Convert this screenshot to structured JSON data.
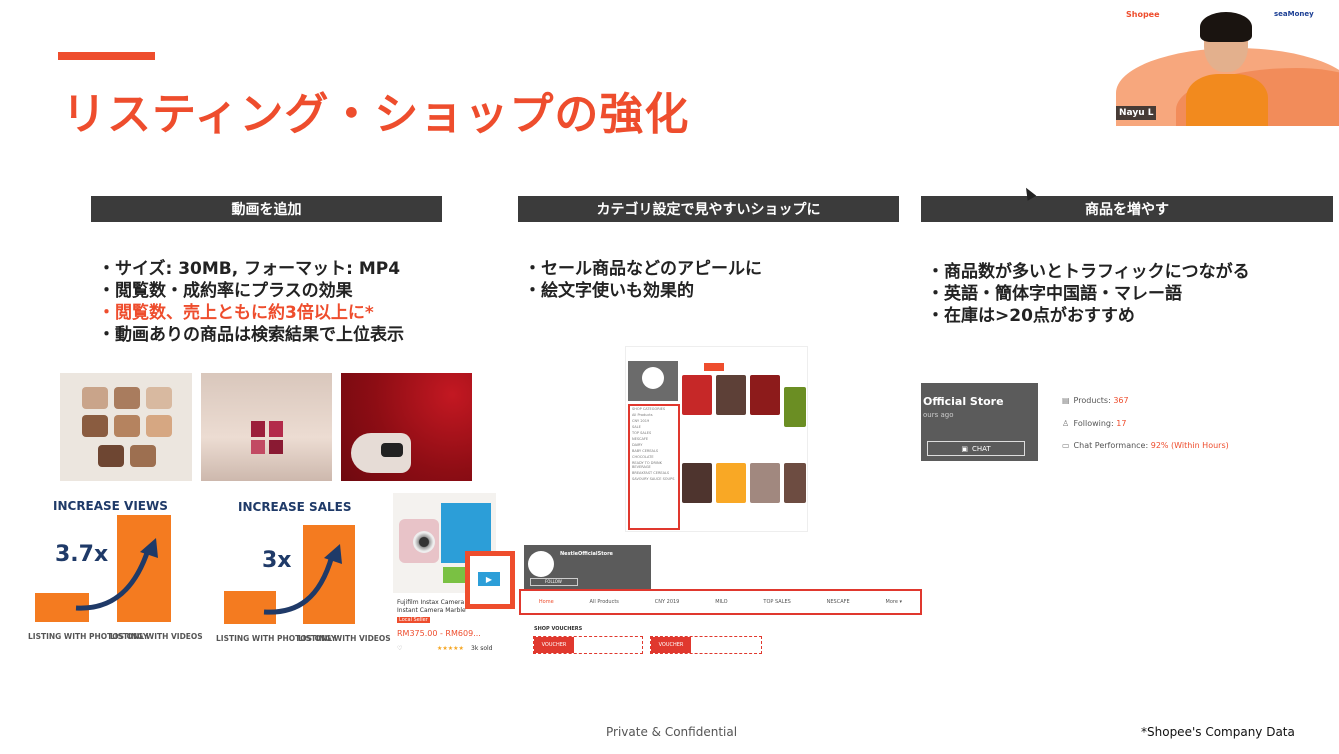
{
  "slide": {
    "title": "リスティング・ショップの強化",
    "accent_color": "#ee4d2d",
    "header_color": "#3b3b3b"
  },
  "columns": [
    {
      "header": "動画を追加",
      "bullets": [
        "・サイズ: 30MB, フォーマット: MP4",
        "・閲覧数・成約率にプラスの効果",
        "・閲覧数、売上ともに約3倍以上に*",
        "・動画ありの商品は検索結果で上位表示"
      ],
      "highlighted_bullet_index": 2
    },
    {
      "header": "カテゴリ設定で見やすいショップに",
      "bullets": [
        "・セール商品などのアピールに",
        "・絵文字使いも効果的"
      ]
    },
    {
      "header": "商品を増やす",
      "bullets": [
        "・商品数が多いとトラフィックにつながる",
        "・英語・簡体字中国語・マレー語",
        "・在庫は>20点がおすすめ"
      ]
    }
  ],
  "chart_data": [
    {
      "type": "bar",
      "title": "INCREASE VIEWS",
      "categories": [
        "LISTING WITH PHOTOS ONLY",
        "LISTING WITH VIDEOS"
      ],
      "values": [
        1,
        3.7
      ],
      "annotation": "3.7x",
      "bar_color": "#f47b20"
    },
    {
      "type": "bar",
      "title": "INCREASE SALES",
      "categories": [
        "LISTING WITH PHOTOS ONLY",
        "LISTING WITH VIDEOS"
      ],
      "values": [
        1,
        3
      ],
      "annotation": "3x",
      "bar_color": "#f47b20"
    }
  ],
  "product_card": {
    "name_line1": "Fujifilm Instax Camera",
    "name_line2": "Instant Camera Marble",
    "price": "RM375.00 - RM609...",
    "seller_tag": "Local Seller",
    "sold": "3k sold",
    "rating": "★★★★★"
  },
  "shop_screenshot": {
    "shop_name": "NestleOfficialStore",
    "follow_label": "FOLLOW",
    "tabs": [
      "Home",
      "All Products",
      "CNY 2019",
      "MILO",
      "TOP SALES",
      "NESCAFE",
      "More ▾"
    ],
    "section_label": "SHOP VOUCHERS",
    "voucher_label": "VOUCHER",
    "categories": [
      "SHOP CATEGORIES",
      "All Products",
      "CNY 2019",
      "SALE",
      "TOP SALES",
      "NESCAFE",
      "DAIRY",
      "BABY CEREALS",
      "CHOCOLATE",
      "READY TO DRINK BEVERAGE",
      "BREAKFAST CEREALS",
      "SAVOURY SAUCE SOUPS"
    ]
  },
  "store_card": {
    "name": "Official Store",
    "subtitle": "ours ago",
    "chat_label": "CHAT",
    "products_label": "Products:",
    "products_value": "367",
    "following_label": "Following:",
    "following_value": "17",
    "chat_perf_label": "Chat Performance:",
    "chat_perf_value": "92% (Within Hours)"
  },
  "footer": {
    "center": "Private & Confidential",
    "right": "*Shopee's Company Data"
  },
  "video_call": {
    "participant_name": "Nayu L",
    "brand_left": "Shopee",
    "brand_right": "seaMoney"
  }
}
